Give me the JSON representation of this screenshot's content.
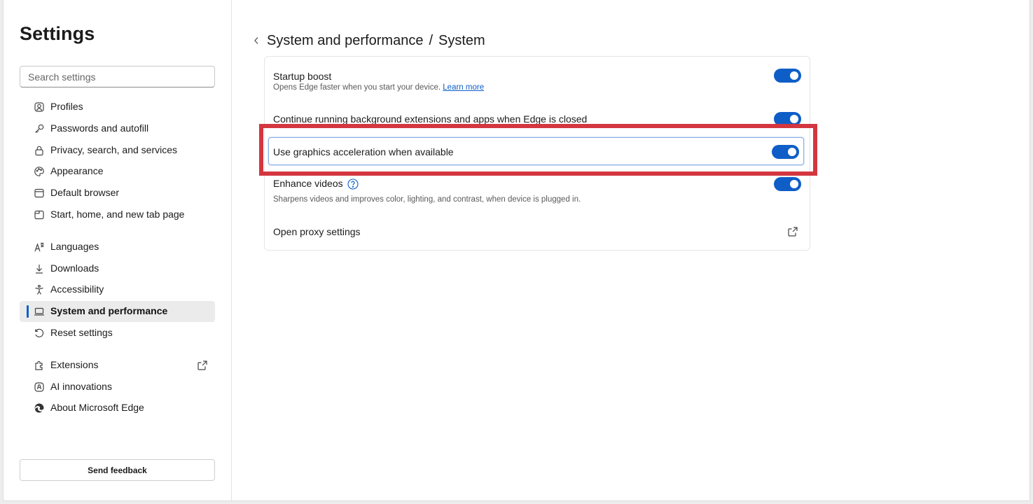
{
  "sidebar": {
    "title": "Settings",
    "search_placeholder": "Search settings",
    "items": [
      {
        "label": "Profiles",
        "icon": "profile-icon"
      },
      {
        "label": "Passwords and autofill",
        "icon": "key-icon"
      },
      {
        "label": "Privacy, search, and services",
        "icon": "lock-icon"
      },
      {
        "label": "Appearance",
        "icon": "palette-icon"
      },
      {
        "label": "Default browser",
        "icon": "browser-icon"
      },
      {
        "label": "Start, home, and new tab page",
        "icon": "home-tab-icon"
      },
      {
        "label": "Languages",
        "icon": "languages-icon"
      },
      {
        "label": "Downloads",
        "icon": "download-icon"
      },
      {
        "label": "Accessibility",
        "icon": "accessibility-icon"
      },
      {
        "label": "System and performance",
        "icon": "laptop-icon",
        "active": true
      },
      {
        "label": "Reset settings",
        "icon": "reset-icon"
      },
      {
        "label": "Extensions",
        "icon": "extensions-icon",
        "external": true
      },
      {
        "label": "AI innovations",
        "icon": "ai-icon"
      },
      {
        "label": "About Microsoft Edge",
        "icon": "edge-icon"
      }
    ],
    "feedback_label": "Send feedback"
  },
  "main": {
    "breadcrumb": {
      "parent": "System and performance",
      "separator": "/",
      "current": "System"
    },
    "settings": [
      {
        "title": "Startup boost",
        "description": "Opens Edge faster when you start your device.",
        "link": "Learn more",
        "enabled": true
      },
      {
        "title": "Continue running background extensions and apps when Edge is closed",
        "enabled": true
      },
      {
        "title": "Use graphics acceleration when available",
        "enabled": true,
        "highlighted": true
      },
      {
        "title": "Enhance videos",
        "description": "Sharpens videos and improves color, lighting, and contrast, when device is plugged in.",
        "enabled": true,
        "help_icon": "help-icon"
      },
      {
        "title": "Open proxy settings",
        "external_icon": "external-link-icon"
      }
    ]
  },
  "colors": {
    "accent": "#0f5ec7",
    "annotation": "#d4363f"
  }
}
